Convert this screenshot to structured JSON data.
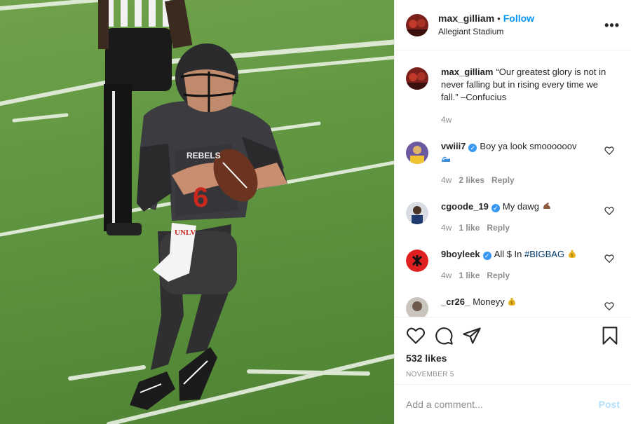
{
  "post": {
    "username": "max_gilliam",
    "follow_label": "Follow",
    "location": "Allegiant Stadium",
    "more_label": "•••",
    "caption": "“Our greatest glory is not in never falling but in rising every time we fall.” –Confucius",
    "caption_time": "4w",
    "likes": "532 likes",
    "date": "November 5",
    "jersey_text": "REBELS",
    "jersey_number": "6",
    "towel_text": "UNLV"
  },
  "comments": [
    {
      "username": "vwiii7",
      "verified": true,
      "text": "Boy ya look smoooooov",
      "emoji": "wave-emoji",
      "time": "4w",
      "likes": "2 likes",
      "reply": "Reply"
    },
    {
      "username": "cgoode_19",
      "verified": true,
      "text": "My dawg",
      "emoji": "flexed-biceps-emoji",
      "time": "4w",
      "likes": "1 like",
      "reply": "Reply"
    },
    {
      "username": "9boyleek",
      "verified": true,
      "text": "All $ In ",
      "hashtag": "#BIGBAG",
      "emoji": "money-bag-emoji",
      "time": "4w",
      "likes": "1 like",
      "reply": "Reply"
    },
    {
      "username": "_cr26_",
      "verified": false,
      "text": "Moneyy",
      "emoji": "money-bag-emoji"
    }
  ],
  "add_comment": {
    "placeholder": "Add a comment...",
    "post_label": "Post"
  },
  "icons": [
    "like-heart-icon",
    "comment-icon",
    "share-icon",
    "save-bookmark-icon",
    "more-options-icon"
  ],
  "colors": {
    "accent": "#0095f6",
    "post_disabled": "#b2dffc",
    "muted": "#8e8e8e",
    "verified": "#3897f0"
  }
}
